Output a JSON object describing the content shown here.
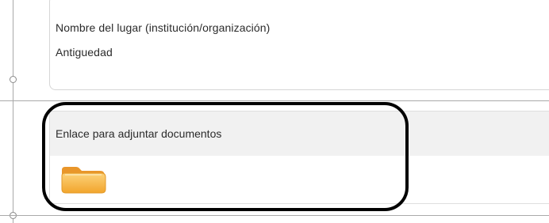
{
  "section_place": {
    "fields": [
      {
        "label": "Nombre del lugar (institución/organización)"
      },
      {
        "label": "Antiguedad"
      }
    ]
  },
  "attachments": {
    "title": "Enlace para adjuntar documentos",
    "icon": "folder-icon"
  },
  "colors": {
    "highlight_border": "#000000",
    "folder_fill": "#f6b23a",
    "panel_header_bg": "#f1f1f1"
  }
}
